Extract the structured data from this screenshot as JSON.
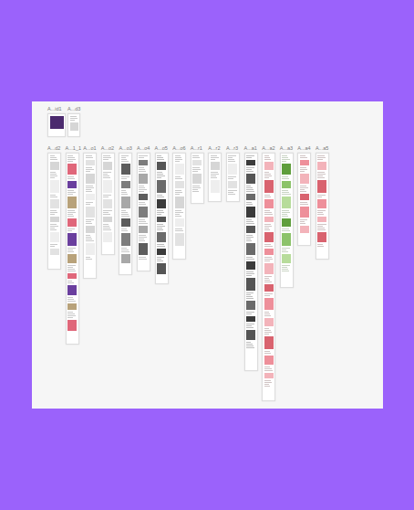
{
  "top_row": [
    {
      "label": "A...id1",
      "kind": "hero"
    },
    {
      "label": "A...d3",
      "kind": "text"
    }
  ],
  "artboards": [
    {
      "label": "A...d2",
      "kind": "text"
    },
    {
      "label": "A...1_1",
      "kind": "mixed"
    },
    {
      "label": "A...o1",
      "kind": "text"
    },
    {
      "label": "A...o2",
      "kind": "text"
    },
    {
      "label": "A...o3",
      "kind": "photo"
    },
    {
      "label": "A...o4",
      "kind": "photo"
    },
    {
      "label": "A...o5",
      "kind": "dark"
    },
    {
      "label": "A...o6",
      "kind": "text"
    },
    {
      "label": "A...r1",
      "kind": "text"
    },
    {
      "label": "A...r2",
      "kind": "text"
    },
    {
      "label": "A...r3",
      "kind": "text"
    },
    {
      "label": "A...a1",
      "kind": "dark"
    },
    {
      "label": "A...a2",
      "kind": "pink"
    },
    {
      "label": "A...a3",
      "kind": "green"
    },
    {
      "label": "A...a4",
      "kind": "pink"
    },
    {
      "label": "A...a5",
      "kind": "pink"
    }
  ]
}
